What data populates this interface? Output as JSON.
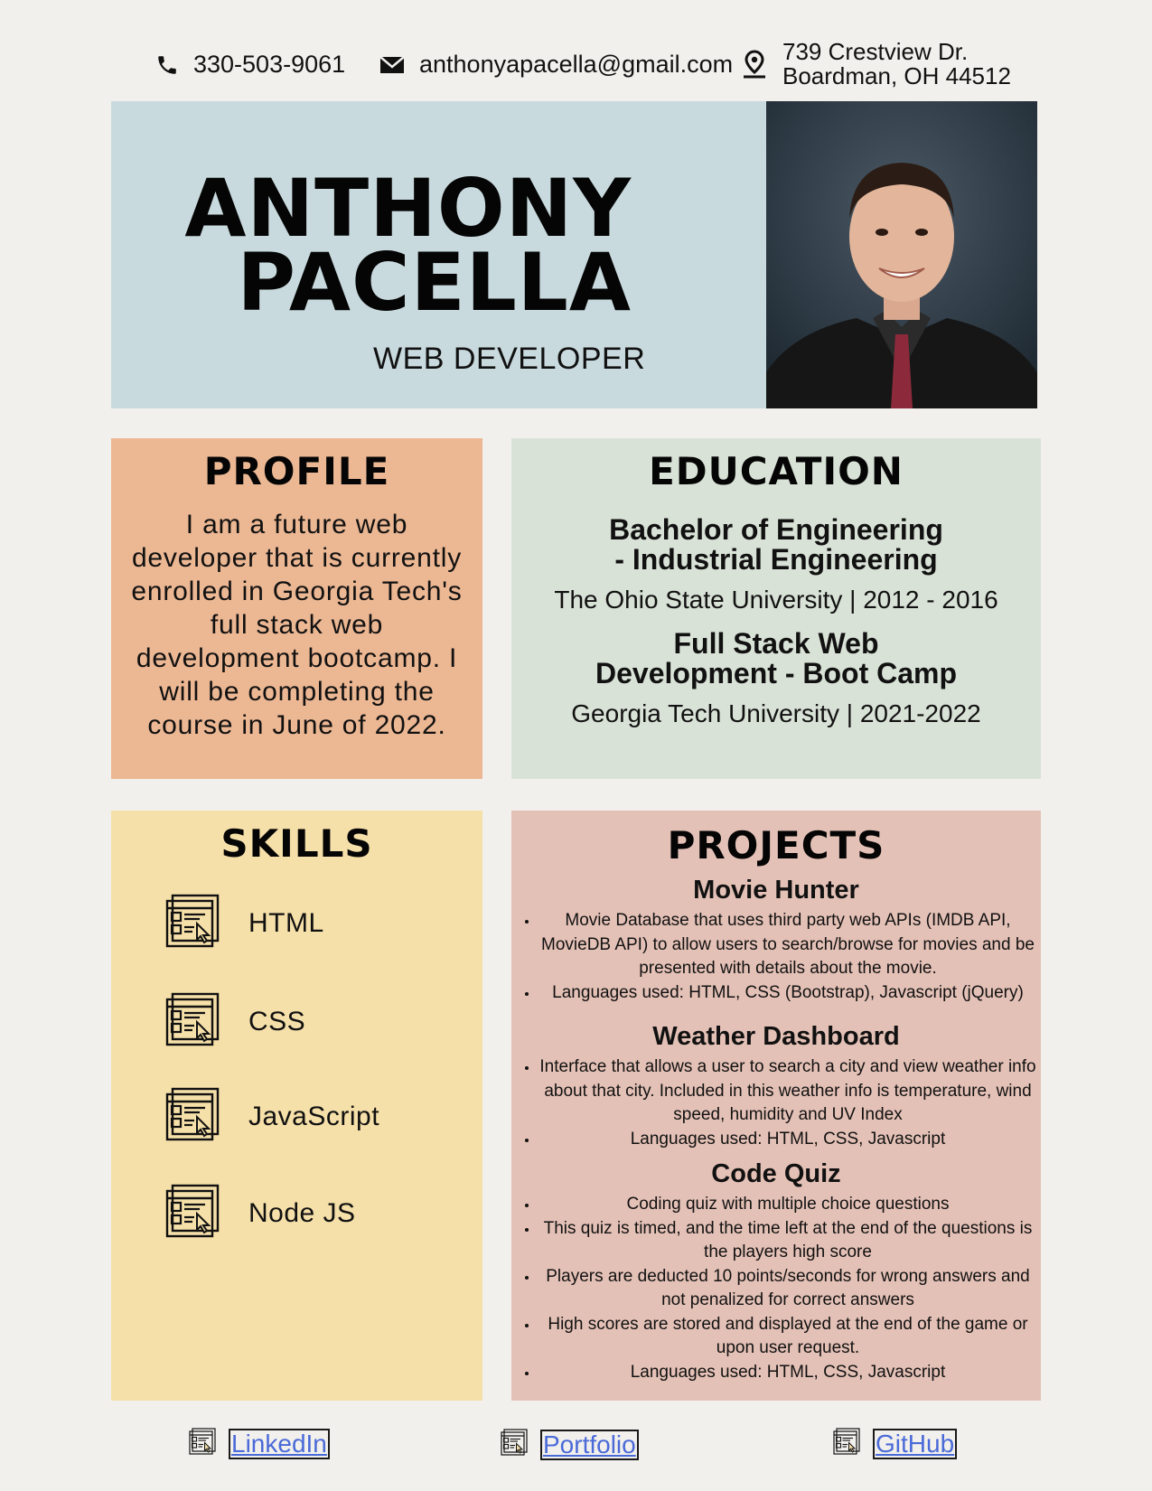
{
  "contact": {
    "phone": "330-503-9061",
    "email": "anthonyapacella@gmail.com",
    "address_line1": "739 Crestview Dr.",
    "address_line2": "Boardman, OH 44512"
  },
  "header": {
    "first_name": "ANTHONY",
    "last_name": "PACELLA",
    "role": "WEB DEVELOPER"
  },
  "profile": {
    "title": "PROFILE",
    "text": "I am a future web developer that is currently enrolled in Georgia Tech's full stack web development bootcamp. I will be completing the course in June of 2022."
  },
  "education": {
    "title": "EDUCATION",
    "entries": [
      {
        "degree_line1": "Bachelor of Engineering",
        "degree_line2": "- Industrial Engineering",
        "school": "The Ohio State University | 2012 - 2016"
      },
      {
        "degree_line1": "Full Stack Web",
        "degree_line2": "Development - Boot Camp",
        "school": "Georgia Tech University | 2021-2022"
      }
    ]
  },
  "skills": {
    "title": "SKILLS",
    "items": [
      {
        "label": "HTML",
        "icon": "web-page-icon"
      },
      {
        "label": "CSS",
        "icon": "web-page-icon"
      },
      {
        "label": "JavaScript",
        "icon": "web-page-icon"
      },
      {
        "label": "Node JS",
        "icon": "web-page-icon"
      }
    ]
  },
  "projects": {
    "title": "PROJECTS",
    "items": [
      {
        "name": "Movie Hunter",
        "bullets": [
          "Movie Database that uses third party web APIs (IMDB API, MovieDB API) to allow users to search/browse for movies and be presented with details about the movie.",
          "Languages used: HTML, CSS (Bootstrap), Javascript (jQuery)"
        ]
      },
      {
        "name": "Weather Dashboard",
        "bullets": [
          "Interface that allows a user to search a city and view weather info about that city. Included in this weather info is temperature, wind speed, humidity and UV Index",
          "Languages used: HTML, CSS, Javascript"
        ]
      },
      {
        "name": "Code Quiz",
        "bullets": [
          "Coding quiz with multiple choice questions",
          "This quiz is timed, and the time left at the end of the questions is the players high score",
          "Players are deducted 10 points/seconds for wrong answers and not penalized for correct answers",
          "High scores are stored and displayed at the end of the game or upon user request.",
          "Languages used: HTML, CSS, Javascript"
        ]
      }
    ]
  },
  "footer": {
    "links": [
      {
        "label": "LinkedIn"
      },
      {
        "label": "Portfolio"
      },
      {
        "label": "GitHub"
      }
    ]
  },
  "colors": {
    "header_bg": "#c9dade",
    "profile_bg": "#ecb793",
    "education_bg": "#d9e2d7",
    "skills_bg": "#f6e0a9",
    "projects_bg": "#e4c1b6",
    "link": "#4a6ad8"
  }
}
